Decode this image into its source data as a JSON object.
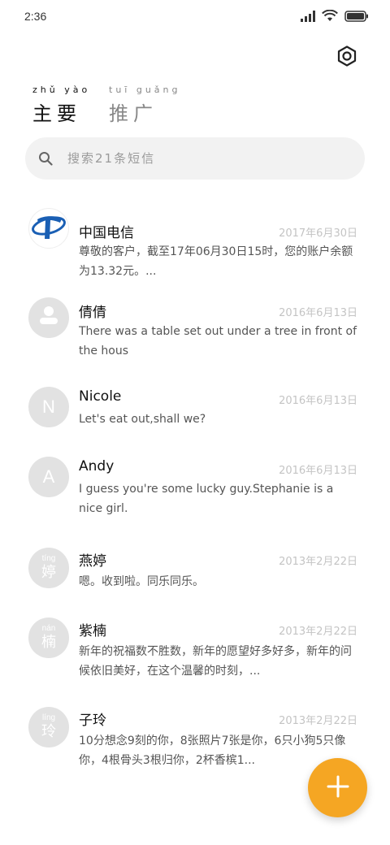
{
  "status_bar": {
    "time": "2:36",
    "icons": [
      "signal-icon",
      "wifi-icon",
      "battery-icon"
    ]
  },
  "header": {
    "settings_icon": "gear-icon",
    "tabs": [
      {
        "label": "主要",
        "pinyin": "zhǔ yào",
        "active": true
      },
      {
        "label": "推广",
        "pinyin": "tuī guǎng",
        "active": false
      }
    ]
  },
  "search": {
    "placeholder": "搜索21条短信",
    "icon": "search-icon"
  },
  "conversations": [
    {
      "name": "中国电信",
      "date": "2017年6月30日",
      "preview": "尊敬的客户，截至17年06月30日15时，您的账户余额为13.32元。...",
      "avatar_type": "logo",
      "avatar_text": "",
      "avatar_color": "#1a5fb4"
    },
    {
      "name": "倩倩",
      "date": "2016年6月13日",
      "preview": "There was a table set out under a tree in front of the hous",
      "avatar_type": "person",
      "avatar_text": "",
      "avatar_color": "#e2e2e2"
    },
    {
      "name": "Nicole",
      "date": "2016年6月13日",
      "preview": "Let's eat out,shall we?",
      "avatar_type": "letter",
      "avatar_text": "N",
      "avatar_color": "#e2e2e2"
    },
    {
      "name": "Andy",
      "date": "2016年6月13日",
      "preview": "I guess you're some lucky guy.Stephanie is a nice girl.",
      "avatar_type": "letter",
      "avatar_text": "A",
      "avatar_color": "#e2e2e2"
    },
    {
      "name": "燕婷",
      "date": "2013年2月22日",
      "preview": "嗯。收到啦。同乐同乐。",
      "avatar_type": "hanzi",
      "avatar_text": "婷",
      "avatar_pinyin": "tíng",
      "avatar_color": "#e2e2e2"
    },
    {
      "name": "紫楠",
      "date": "2013年2月22日",
      "preview": "新年的祝福数不胜数，新年的愿望好多好多，新年的问候依旧美好，在这个温馨的时刻，...",
      "avatar_type": "hanzi",
      "avatar_text": "楠",
      "avatar_pinyin": "nán",
      "avatar_color": "#e2e2e2"
    },
    {
      "name": "子玲",
      "date": "2013年2月22日",
      "preview": "10分想念9刻的你，8张照片7张是你，6只小狗5只像你，4根骨头3根归你，2杯香槟1...",
      "avatar_type": "hanzi",
      "avatar_text": "玲",
      "avatar_pinyin": "líng",
      "avatar_color": "#e2e2e2"
    }
  ],
  "fab": {
    "icon": "plus-icon",
    "color": "#f5a623"
  }
}
